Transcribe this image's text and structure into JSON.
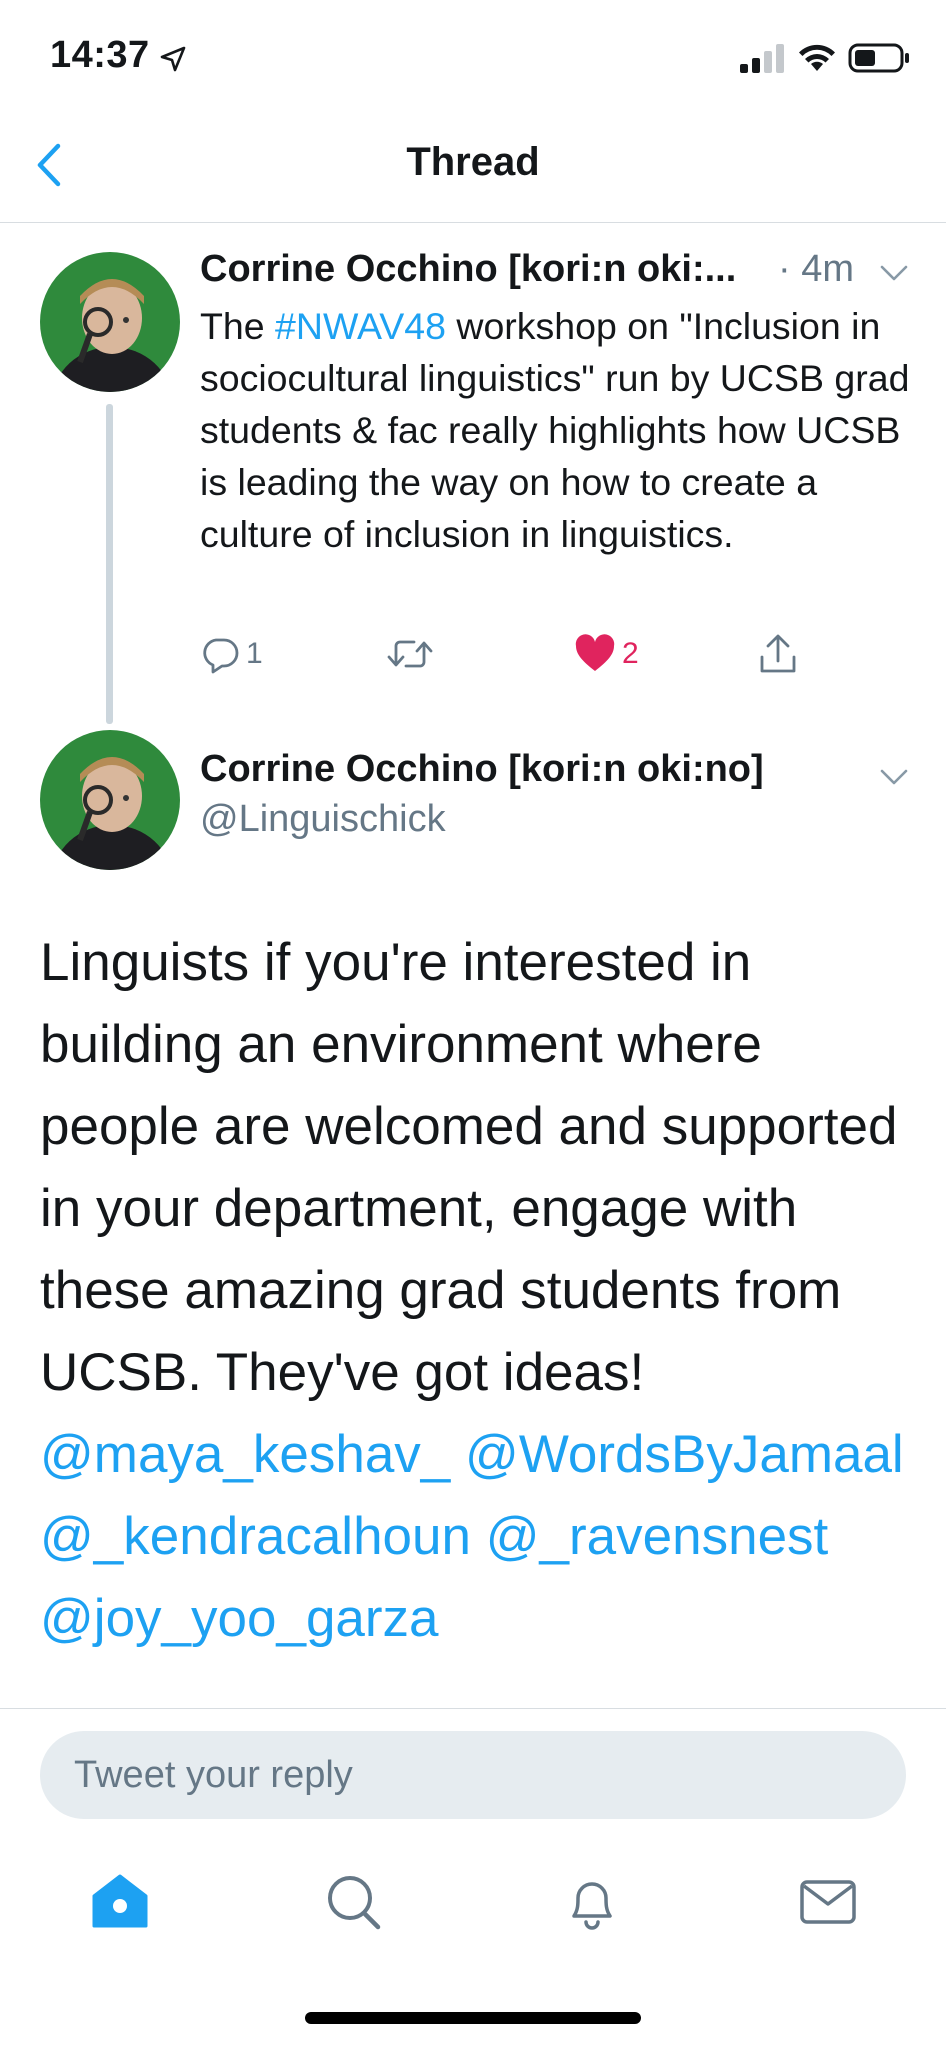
{
  "status_bar": {
    "time": "14:37",
    "icons": [
      "location-arrow-icon",
      "cellular-signal-icon",
      "wifi-icon",
      "battery-icon"
    ]
  },
  "nav": {
    "title": "Thread",
    "back_icon": "chevron-left-icon"
  },
  "colors": {
    "accent": "#1da1f2",
    "like": "#e0245e",
    "secondary_text": "#657786",
    "input_bg": "#e6ecf0"
  },
  "tweets": [
    {
      "author_name": "Corrine Occhino [kori:n oki:...",
      "time": "· 4m",
      "text_parts": {
        "before": "The ",
        "hashtag": "#NWAV48",
        "after": " workshop on \"Inclusion in sociocultural linguistics\" run by UCSB grad students & fac really highlights how UCSB is leading the way on how to create a culture of inclusion in linguistics."
      },
      "actions": {
        "reply_count": "1",
        "retweet_count": "",
        "like_count": "2",
        "liked": true
      }
    },
    {
      "author_name": "Corrine Occhino [kori:n oki:no]",
      "handle": "@Linguischick",
      "text_before": "Linguists if you're interested in building an environment where people are welcomed and supported in your department, engage with these amazing grad students from UCSB. They've got ideas! ",
      "mentions": [
        "@maya_keshav_",
        "@WordsByJamaal",
        "@_kendracalhoun",
        "@_ravensnest",
        "@joy_yoo_garza"
      ]
    }
  ],
  "reply": {
    "placeholder": "Tweet your reply"
  },
  "tab_bar": {
    "tabs": [
      "home-icon",
      "search-icon",
      "notifications-bell-icon",
      "messages-envelope-icon"
    ],
    "active": "home-icon"
  }
}
